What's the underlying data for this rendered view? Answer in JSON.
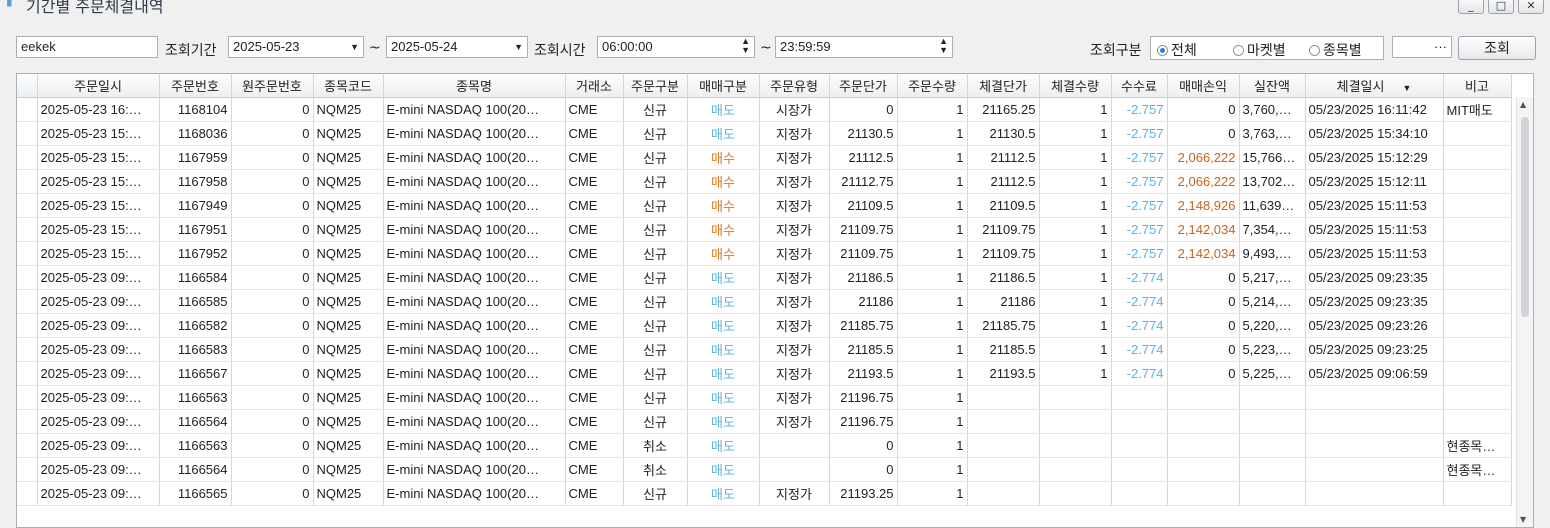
{
  "window": {
    "title": "기간별 주문체결내역",
    "min_label": "_",
    "max_label": "□",
    "close_label": "✕"
  },
  "filter": {
    "account": "eekek",
    "period_label": "조회기간",
    "date_from": "2025-05-23",
    "tilde": "~",
    "date_to": "2025-05-24",
    "time_label": "조회시간",
    "time_from": "06:00:00",
    "time_to": "23:59:59",
    "kind_label": "조회구분",
    "radio_all": "전체",
    "radio_market": "마켓별",
    "radio_symbol": "종목별",
    "ellipsis": "···",
    "search_button": "조회"
  },
  "table": {
    "columns": [
      "주문일시",
      "주문번호",
      "원주문번호",
      "종목코드",
      "종목명",
      "거래소",
      "주문구분",
      "매매구분",
      "주문유형",
      "주문단가",
      "주문수량",
      "체결단가",
      "체결수량",
      "수수료",
      "매매손익",
      "실잔액",
      "체결일시",
      "비고"
    ],
    "rows": [
      [
        "2025-05-23 16:…",
        "1168104",
        "0",
        "NQM25",
        "E-mini NASDAQ 100(20…",
        "CME",
        "신규",
        "매도",
        "시장가",
        "0",
        "1",
        "21165.25",
        "1",
        "-2.757",
        "0",
        "3,760,…",
        "05/23/2025 16:11:42",
        "MIT매도"
      ],
      [
        "2025-05-23 15:…",
        "1168036",
        "0",
        "NQM25",
        "E-mini NASDAQ 100(20…",
        "CME",
        "신규",
        "매도",
        "지정가",
        "21130.5",
        "1",
        "21130.5",
        "1",
        "-2.757",
        "0",
        "3,763,…",
        "05/23/2025 15:34:10",
        ""
      ],
      [
        "2025-05-23 15:…",
        "1167959",
        "0",
        "NQM25",
        "E-mini NASDAQ 100(20…",
        "CME",
        "신규",
        "매수",
        "지정가",
        "21112.5",
        "1",
        "21112.5",
        "1",
        "-2.757",
        "2,066,222",
        "15,766…",
        "05/23/2025 15:12:29",
        ""
      ],
      [
        "2025-05-23 15:…",
        "1167958",
        "0",
        "NQM25",
        "E-mini NASDAQ 100(20…",
        "CME",
        "신규",
        "매수",
        "지정가",
        "21112.75",
        "1",
        "21112.5",
        "1",
        "-2.757",
        "2,066,222",
        "13,702…",
        "05/23/2025 15:12:11",
        ""
      ],
      [
        "2025-05-23 15:…",
        "1167949",
        "0",
        "NQM25",
        "E-mini NASDAQ 100(20…",
        "CME",
        "신규",
        "매수",
        "지정가",
        "21109.5",
        "1",
        "21109.5",
        "1",
        "-2.757",
        "2,148,926",
        "11,639…",
        "05/23/2025 15:11:53",
        ""
      ],
      [
        "2025-05-23 15:…",
        "1167951",
        "0",
        "NQM25",
        "E-mini NASDAQ 100(20…",
        "CME",
        "신규",
        "매수",
        "지정가",
        "21109.75",
        "1",
        "21109.75",
        "1",
        "-2.757",
        "2,142,034",
        "7,354,…",
        "05/23/2025 15:11:53",
        ""
      ],
      [
        "2025-05-23 15:…",
        "1167952",
        "0",
        "NQM25",
        "E-mini NASDAQ 100(20…",
        "CME",
        "신규",
        "매수",
        "지정가",
        "21109.75",
        "1",
        "21109.75",
        "1",
        "-2.757",
        "2,142,034",
        "9,493,…",
        "05/23/2025 15:11:53",
        ""
      ],
      [
        "2025-05-23 09:…",
        "1166584",
        "0",
        "NQM25",
        "E-mini NASDAQ 100(20…",
        "CME",
        "신규",
        "매도",
        "지정가",
        "21186.5",
        "1",
        "21186.5",
        "1",
        "-2.774",
        "0",
        "5,217,…",
        "05/23/2025 09:23:35",
        ""
      ],
      [
        "2025-05-23 09:…",
        "1166585",
        "0",
        "NQM25",
        "E-mini NASDAQ 100(20…",
        "CME",
        "신규",
        "매도",
        "지정가",
        "21186",
        "1",
        "21186",
        "1",
        "-2.774",
        "0",
        "5,214,…",
        "05/23/2025 09:23:35",
        ""
      ],
      [
        "2025-05-23 09:…",
        "1166582",
        "0",
        "NQM25",
        "E-mini NASDAQ 100(20…",
        "CME",
        "신규",
        "매도",
        "지정가",
        "21185.75",
        "1",
        "21185.75",
        "1",
        "-2.774",
        "0",
        "5,220,…",
        "05/23/2025 09:23:26",
        ""
      ],
      [
        "2025-05-23 09:…",
        "1166583",
        "0",
        "NQM25",
        "E-mini NASDAQ 100(20…",
        "CME",
        "신규",
        "매도",
        "지정가",
        "21185.5",
        "1",
        "21185.5",
        "1",
        "-2.774",
        "0",
        "5,223,…",
        "05/23/2025 09:23:25",
        ""
      ],
      [
        "2025-05-23 09:…",
        "1166567",
        "0",
        "NQM25",
        "E-mini NASDAQ 100(20…",
        "CME",
        "신규",
        "매도",
        "지정가",
        "21193.5",
        "1",
        "21193.5",
        "1",
        "-2.774",
        "0",
        "5,225,…",
        "05/23/2025 09:06:59",
        ""
      ],
      [
        "2025-05-23 09:…",
        "1166563",
        "0",
        "NQM25",
        "E-mini NASDAQ 100(20…",
        "CME",
        "신규",
        "매도",
        "지정가",
        "21196.75",
        "1",
        "",
        "",
        "",
        "",
        "",
        "",
        ""
      ],
      [
        "2025-05-23 09:…",
        "1166564",
        "0",
        "NQM25",
        "E-mini NASDAQ 100(20…",
        "CME",
        "신규",
        "매도",
        "지정가",
        "21196.75",
        "1",
        "",
        "",
        "",
        "",
        "",
        "",
        ""
      ],
      [
        "2025-05-23 09:…",
        "1166563",
        "0",
        "NQM25",
        "E-mini NASDAQ 100(20…",
        "CME",
        "취소",
        "매도",
        "",
        "0",
        "1",
        "",
        "",
        "",
        "",
        "",
        "",
        "현종목…"
      ],
      [
        "2025-05-23 09:…",
        "1166564",
        "0",
        "NQM25",
        "E-mini NASDAQ 100(20…",
        "CME",
        "취소",
        "매도",
        "",
        "0",
        "1",
        "",
        "",
        "",
        "",
        "",
        "",
        "현종목…"
      ],
      [
        "2025-05-23 09:…",
        "1166565",
        "0",
        "NQM25",
        "E-mini NASDAQ 100(20…",
        "CME",
        "신규",
        "매도",
        "지정가",
        "21193.25",
        "1",
        "",
        "",
        "",
        "",
        "",
        "",
        ""
      ]
    ]
  },
  "colors": {
    "buy": "#e07a1f",
    "sell": "#5ab2de",
    "profit": "#c8641a"
  }
}
